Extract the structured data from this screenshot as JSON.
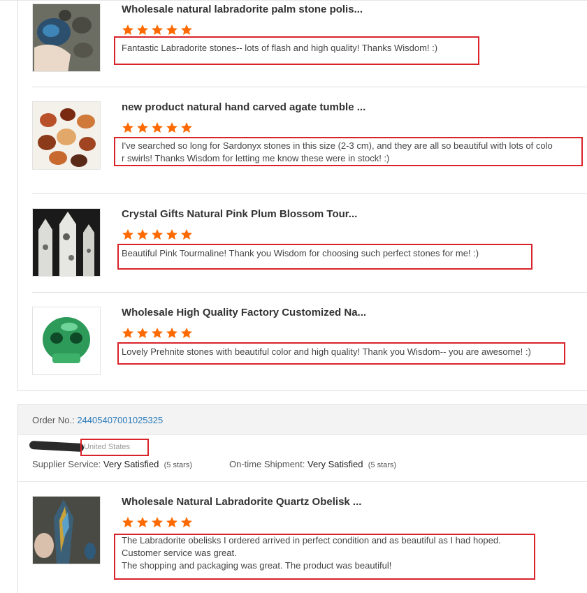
{
  "reviews": [
    {
      "title": "Wholesale natural labradorite palm stone polis...",
      "comment": "Fantastic Labradorite stones-- lots of flash and high quality! Thanks Wisdom!  :)",
      "stars": 5
    },
    {
      "title": "new product natural hand carved agate tumble ...",
      "comment_line1": "I've searched so long for Sardonyx stones in this size (2-3 cm), and they are all so beautiful with lots of colo",
      "comment_line2": "r swirls! Thanks Wisdom for letting me know these were in stock!  :)",
      "stars": 5
    },
    {
      "title": "Crystal Gifts Natural Pink Plum Blossom Tour...",
      "comment": "Beautiful Pink Tourmaline! Thank you Wisdom for choosing such perfect stones for me!  :)",
      "stars": 5
    },
    {
      "title": "Wholesale High Quality Factory Customized Na...",
      "comment": "Lovely Prehnite stones with beautiful color and high quality! Thank you Wisdom-- you are awesome!  :)",
      "stars": 5
    }
  ],
  "order": {
    "label": "Order No.:",
    "number": "24405407001025325",
    "country": "United States",
    "supplier_label": "Supplier Service:",
    "supplier_value": "Very Satisfied",
    "supplier_stars": "(5 stars)",
    "shipment_label": "On-time Shipment:",
    "shipment_value": "Very Satisfied",
    "shipment_stars": "(5 stars)",
    "review": {
      "title": "Wholesale Natural Labradorite Quartz Obelisk ...",
      "line1": "The Labradorite obelisks I ordered arrived in perfect condition and as beautiful as I had hoped.",
      "line2": "Customer service was great.",
      "line3": "The shopping and packaging was great.  The product was beautiful!",
      "stars": 5
    }
  },
  "colors": {
    "star": "#ff6a00",
    "highlight": "#d9232a",
    "link": "#2a7ab8"
  }
}
